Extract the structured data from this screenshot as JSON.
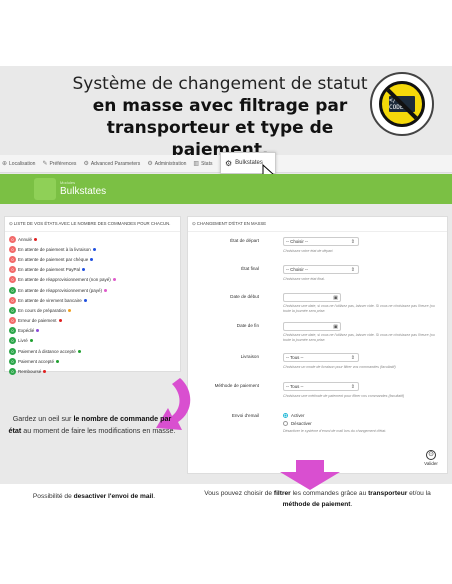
{
  "headline": {
    "line1": "Système de changement de statut",
    "line2": "en masse avec filtrage par",
    "line3": "transporteur et type de paiement."
  },
  "badge": {
    "ring_text": "SANS MODIFICATION DU CODE",
    "screen_text": "</ CODE>"
  },
  "topbar": {
    "tabs": [
      "Localisation",
      "Préférences",
      "Advanced Parameters",
      "Administration",
      "Stats"
    ],
    "active_tab": "Bulkstates"
  },
  "module_header": {
    "breadcrumb": "Modules",
    "title": "Bulkstates"
  },
  "left_panel": {
    "title": "LISTE DE VOS ÉTATS AVEC LE NOMBRE DES COMMANDES POUR CHACUN.",
    "statuses": [
      {
        "count": "0",
        "label": "Annulé",
        "badge": "#f26a6a",
        "dot": "#e02020"
      },
      {
        "count": "0",
        "label": "En attente de paiement à la livraison",
        "badge": "#f26a6a",
        "dot": "#2050e0"
      },
      {
        "count": "0",
        "label": "En attente de paiement par chèque",
        "badge": "#f26a6a",
        "dot": "#2050e0"
      },
      {
        "count": "0",
        "label": "En attente de paiement PayPal",
        "badge": "#f26a6a",
        "dot": "#2050e0"
      },
      {
        "count": "0",
        "label": "En attente de réapprovisionnement (non payé)",
        "badge": "#f26a6a",
        "dot": "#e05acb"
      },
      {
        "count": "0",
        "label": "En attente de réapprovisionnement (payé)",
        "badge": "#2ca64a",
        "dot": "#e05acb"
      },
      {
        "count": "0",
        "label": "En attente de virement bancaire",
        "badge": "#f26a6a",
        "dot": "#2050e0"
      },
      {
        "count": "0",
        "label": "En cours de préparation",
        "badge": "#2ca64a",
        "dot": "#f0a020"
      },
      {
        "count": "0",
        "label": "Erreur de paiement",
        "badge": "#f26a6a",
        "dot": "#e02020"
      },
      {
        "count": "0",
        "label": "Expédié",
        "badge": "#2ca64a",
        "dot": "#8a4ad6"
      },
      {
        "count": "0",
        "label": "Livré",
        "badge": "#2ca64a",
        "dot": "#20a030"
      },
      {
        "count": "0",
        "label": "Paiement à distance accepté",
        "badge": "#2ca64a",
        "dot": "#20a030"
      },
      {
        "count": "0",
        "label": "Paiement accepté",
        "badge": "#2ca64a",
        "dot": "#20a030"
      },
      {
        "count": "0",
        "label": "Remboursé",
        "badge": "#2ca64a",
        "dot": "#e02020"
      }
    ]
  },
  "right_panel": {
    "title": "CHANGEMENT D'ÉTAT EN MASSE",
    "fields": {
      "etat_depart": {
        "label": "État de départ",
        "value": "-- Choisir --",
        "help": "Choisissez votre état de départ."
      },
      "etat_final": {
        "label": "État final",
        "value": "-- Choisir --",
        "help": "Choisissez votre état final."
      },
      "date_debut": {
        "label": "Date de début",
        "help": "Choisissez une date, si vous ne l'utilisez pas, laisser vide. Si vous ne choisissez pas l'heure (ou toute la journée sera prise."
      },
      "date_fin": {
        "label": "Date de fin",
        "help": "Choisissez une date, si vous ne l'utilisez pas, laisser vide. Si vous ne choisissez pas l'heure (ou toute la journée sera prise."
      },
      "livraison": {
        "label": "Livraison",
        "value": "-- Tous --",
        "help": "Choisissez un mode de livraison pour filtrer vos commandes (facultatif)"
      },
      "methode": {
        "label": "Méthode de paiement",
        "value": "-- Tous --",
        "help": "Choisissez une méthode de paiement pour filtrer vos commandes (facultatif)"
      },
      "email": {
        "label": "Envoi d'email",
        "opt_on": "Activer",
        "opt_off": "Désactiver",
        "help": "Désactiver le système d'envoi de mail lors du changement d'état."
      }
    },
    "save_label": "Valider"
  },
  "notes": {
    "left_1": "Gardez un oeil sur ",
    "left_bold": "le nombre de commande par état",
    "left_2": " au moment de faire les modifications en masse.",
    "bottom_left_1": "Possibilité de ",
    "bottom_left_bold": "desactiver l'envoi de mail",
    "bottom_left_2": ".",
    "bottom_right_1": "Vous pouvez choisir de ",
    "bottom_right_b1": "filtrer",
    "bottom_right_2": " les commandes grâce au ",
    "bottom_right_b2": "transporteur",
    "bottom_right_3": " et/ou la ",
    "bottom_right_b3": "méthode de paiement",
    "bottom_right_4": "."
  },
  "colors": {
    "accent_green": "#7bc044",
    "arrow_magenta": "#d94fd0",
    "radio_blue": "#25b9d7"
  }
}
